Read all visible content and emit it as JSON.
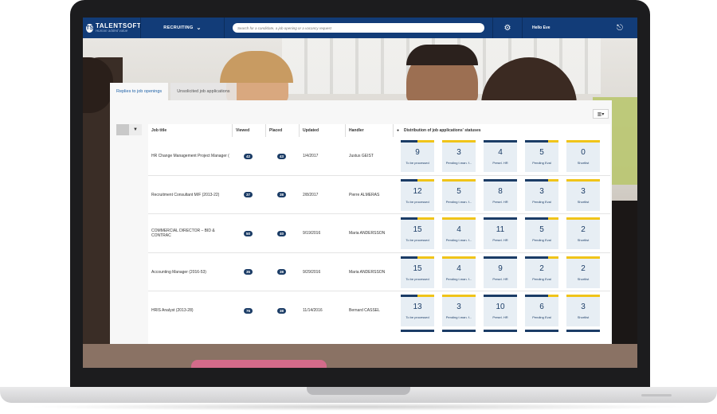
{
  "nav": {
    "logo_name": "TALENTSOFT",
    "logo_tagline": "Human added value",
    "logo_mark": "TS",
    "section": "RECRUITING",
    "search_placeholder": "Search for a candidate, a job opening or a vacancy request",
    "user": "Hello Eve",
    "icons": [
      "gear-icon",
      "logout-icon",
      "chevron-down-icon"
    ]
  },
  "tabs": [
    {
      "label": "Replies to job openings",
      "active": true
    },
    {
      "label": "Unsolicited job applications",
      "active": false
    }
  ],
  "table": {
    "headers": {
      "job_title": "Job title",
      "viewed": "Viewed",
      "placed": "Placed",
      "updated": "Updated",
      "handler": "Handler",
      "distribution": "Distribution of job applications' statuses"
    },
    "rows": [
      {
        "job_title": "HR Change Management Project Manager (",
        "viewed": "42",
        "placed": "43",
        "updated": "1/4/2017",
        "handler": "Justus GEIST",
        "statuses": [
          "9",
          "3",
          "4",
          "5",
          "0"
        ]
      },
      {
        "job_title": "Recruitment Consultant M/F (2013-22)",
        "viewed": "37",
        "placed": "38",
        "updated": "2/8/2017",
        "handler": "Pierre ALMERAS",
        "statuses": [
          "12",
          "5",
          "8",
          "3",
          "3"
        ]
      },
      {
        "job_title": "COMMERCIAL DIRECTOR – BID & CONTRAC",
        "viewed": "50",
        "placed": "40",
        "updated": "9/19/2016",
        "handler": "Maria ANDERSSON",
        "statuses": [
          "15",
          "4",
          "11",
          "5",
          "2"
        ]
      },
      {
        "job_title": "Accounting Manager (2016-53)",
        "viewed": "35",
        "placed": "38",
        "updated": "9/29/2016",
        "handler": "Maria ANDERSSON",
        "statuses": [
          "15",
          "4",
          "9",
          "2",
          "2"
        ]
      },
      {
        "job_title": "HRIS Analyst (2013-28)",
        "viewed": "76",
        "placed": "38",
        "updated": "11/14/2016",
        "handler": "Bernard CASSEL",
        "statuses": [
          "13",
          "3",
          "10",
          "6",
          "3"
        ]
      }
    ],
    "status_labels": [
      "To be processed",
      "Pending t.man. f...",
      "Presel. HR",
      "Pending Eval",
      "Shortlist"
    ]
  },
  "colors": {
    "nav": "#123c78",
    "tile": "#e7eef4",
    "accent_yellow": "#f0c419",
    "accent_navy": "#1b3c66"
  }
}
